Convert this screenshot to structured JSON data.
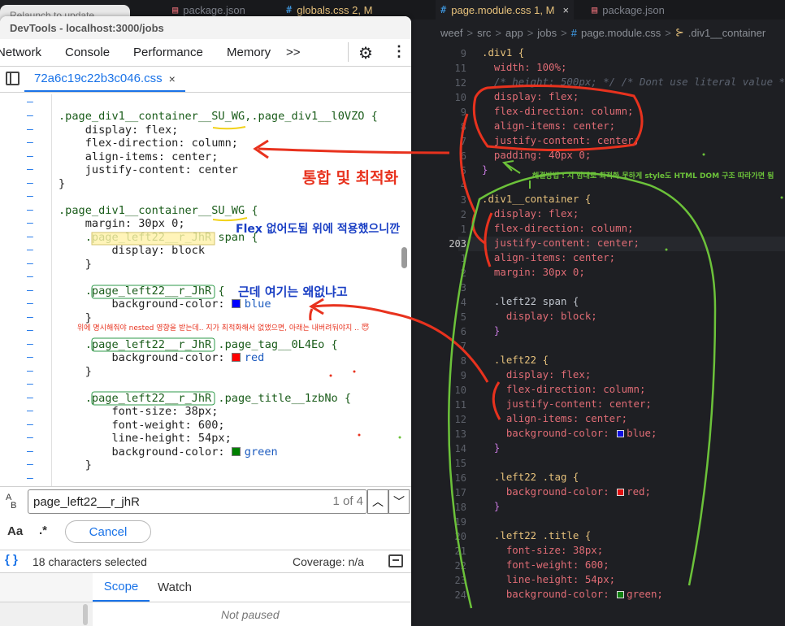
{
  "background_window": {
    "title": "Relaunch to update"
  },
  "devtools": {
    "title": "DevTools - localhost:3000/jobs",
    "tabs": [
      "Network",
      "Console",
      "Performance",
      "Memory",
      ">>"
    ],
    "file_tab": "72a6c19c22b3c046.css",
    "file_close": "×",
    "search": {
      "value": "page_left22__r_jhR",
      "count": "1 of 4"
    },
    "search_options": {
      "case": "Aa",
      "regex": ".*",
      "cancel": "Cancel"
    },
    "status": {
      "selection": "18 characters selected",
      "coverage": "Coverage: n/a"
    },
    "bottom_tabs": {
      "scope": "Scope",
      "watch": "Watch"
    },
    "not_paused": "Not paused",
    "source_lines": [
      ".page_div1__container__SU_WG,.page_div1__l0VZO {",
      "    display: flex;",
      "    flex-direction: column;",
      "    align-items: center;",
      "    justify-content: center",
      "}",
      ".page_div1__container__SU_WG {",
      "    margin: 30px 0;",
      "    .page_left22__r_JhR span {",
      "        display: block",
      "    }",
      "    .page_left22__r_JhR {",
      "        background-color: ",
      "blue",
      "    }",
      "    .page_left22__r_JhR .page_tag__0L4Eo {",
      "        background-color: ",
      "red",
      "    }",
      "    .page_left22__r_JhR .page_title__1zbNo {",
      "        font-size: 38px;",
      "        font-weight: 600;",
      "        line-height: 54px;",
      "        background-color: ",
      "green",
      "    }"
    ]
  },
  "vscode": {
    "tabs": [
      {
        "label": "package.json",
        "icon": "{}"
      },
      {
        "label": "globals.css",
        "badge": "2, M",
        "icon": "#"
      },
      {
        "label": "page.module.css",
        "badge": "1, M",
        "icon": "#",
        "close": "×"
      },
      {
        "label": "package.json",
        "icon": "{}"
      }
    ],
    "breadcrumbs": [
      "weef",
      ">",
      "src",
      ">",
      "app",
      ">",
      "jobs",
      ">",
      "page.module.css",
      ">",
      ".div1__container"
    ],
    "line_numbers": [
      "9",
      "11",
      "12",
      "",
      "10",
      "9",
      "8",
      "7",
      "6",
      "5",
      "4",
      "3",
      "2",
      "1",
      "203",
      "1",
      "2",
      "3",
      "4",
      "5",
      "6",
      "7",
      "8",
      "9",
      "10",
      "11",
      "12",
      "13",
      "14",
      "15",
      "16",
      "17",
      "18",
      "19",
      "20",
      "21",
      "22",
      "23",
      "24"
    ],
    "code": [
      {
        "t": ".div1 {"
      },
      {
        "t": "  width: 100%;"
      },
      {
        "t": "  /* height: 500px; */ /* Dont use literal value */"
      },
      {
        "t": "  display: flex;"
      },
      {
        "t": "  flex-direction: column;"
      },
      {
        "t": "  align-items: center;"
      },
      {
        "t": "  justify-content: center;"
      },
      {
        "t": "  padding: 40px 0;"
      },
      {
        "t": "}"
      },
      {
        "t": ""
      },
      {
        "t": ".div1__container {"
      },
      {
        "t": "  display: flex;"
      },
      {
        "t": "  flex-direction: column;"
      },
      {
        "t": "  justify-content: center;"
      },
      {
        "t": "  align-items: center;"
      },
      {
        "t": "  margin: 30px 0;"
      },
      {
        "t": ""
      },
      {
        "t": "  .left22 span {"
      },
      {
        "t": "    display: block;"
      },
      {
        "t": "  }"
      },
      {
        "t": ""
      },
      {
        "t": "  .left22 {"
      },
      {
        "t": "    display: flex;"
      },
      {
        "t": "    flex-direction: column;"
      },
      {
        "t": "    justify-content: center;"
      },
      {
        "t": "    align-items: center;"
      },
      {
        "t": "    background-color: "
      },
      {
        "t": "blue;"
      },
      {
        "t": "  }"
      },
      {
        "t": ""
      },
      {
        "t": "  .left22 .tag {"
      },
      {
        "t": "    background-color: "
      },
      {
        "t": "red;"
      },
      {
        "t": "  }"
      },
      {
        "t": ""
      },
      {
        "t": "  .left22 .title {"
      },
      {
        "t": "    font-size: 38px;"
      },
      {
        "t": "    font-weight: 600;"
      },
      {
        "t": "    line-height: 54px;"
      },
      {
        "t": "    background-color: "
      },
      {
        "t": "green;"
      }
    ]
  },
  "annotations": {
    "merge": "통합 및 최적화",
    "flex_note": "Flex 없어도됨 위에 적용했으니깐",
    "why_gone": "근데 여기는 왜없냐고",
    "nested_note": "위에 명시해줘야 nested 영향을 받는데.. 지가 최적화해서 없앴으면, 아래는 내버려둬야지 .. 😇",
    "solution": "해결방법 : 지 맘대로 최적화 못하게 style도 HTML DOM 구조 따라가면 됨"
  },
  "colors": {
    "annotation_red": "#e8321e",
    "annotation_green": "#6cc23a",
    "annotation_blue": "#1a3fc4",
    "devtools_link": "#1a73e8"
  }
}
